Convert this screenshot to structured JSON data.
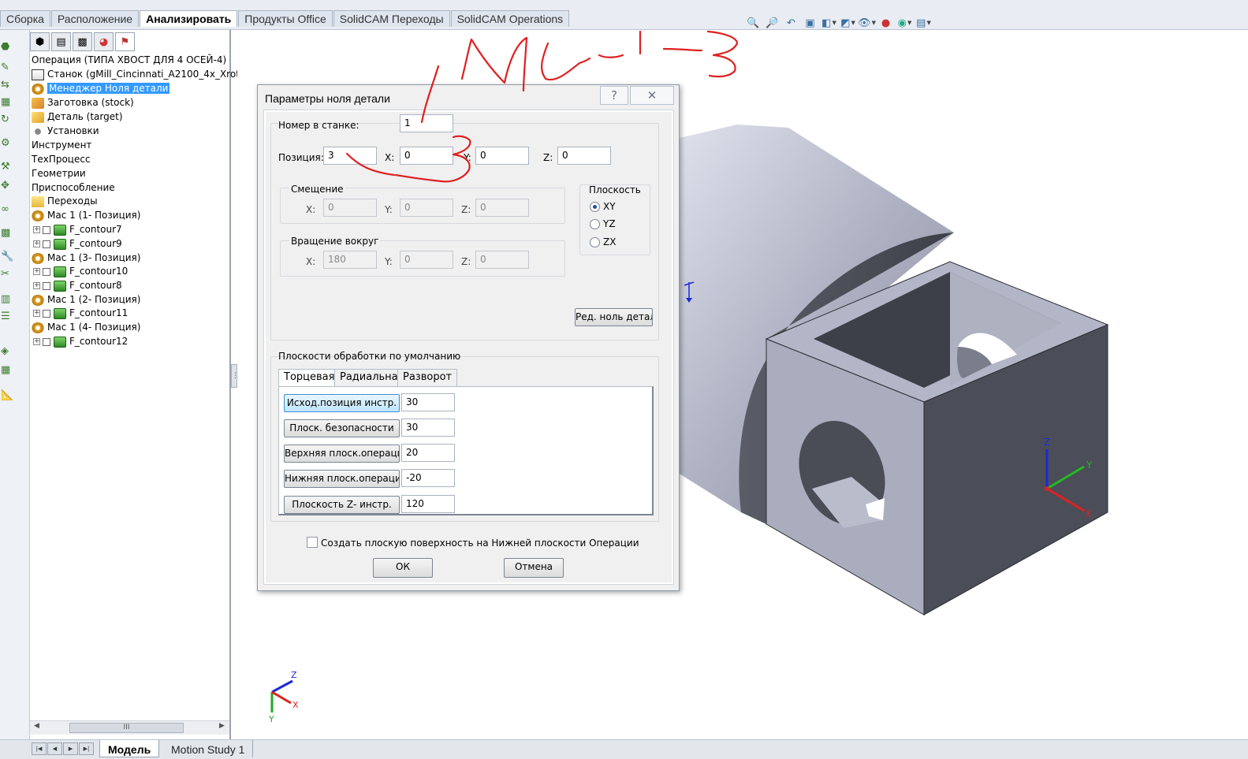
{
  "ribbon": {
    "tabs": [
      "Сборка",
      "Расположение",
      "Анализировать",
      "Продукты Office",
      "SolidCAM Переходы",
      "SolidCAM Operations"
    ],
    "active_tab": "Анализировать"
  },
  "view_toolbar": {
    "icons": [
      "zoom-to-fit-icon",
      "zoom-area-icon",
      "previous-view-icon",
      "section-view-icon",
      "view-orientation-icon",
      "display-style-icon",
      "hide-show-icon",
      "appearance-icon",
      "scene-icon",
      "view-settings-icon"
    ]
  },
  "tree": {
    "root": "Операция (ТИПА ХВОСТ ДЛЯ 4 ОСЕЙ-4)",
    "machine": "Станок (gMill_Cincinnati_A2100_4x_Xrot",
    "part_zero_manager": "Менеджер Ноля детали",
    "stock": "Заготовка (stock)",
    "target": "Деталь (target)",
    "setups": "Установки",
    "tool": "Инструмент",
    "process": "ТехПроцесс",
    "geometry": "Геометрии",
    "fixture": "Приспособление",
    "operations": "Переходы",
    "groups": [
      {
        "label": "Мас 1 (1- Позиция)",
        "items": [
          "F_contour7",
          "F_contour9"
        ]
      },
      {
        "label": "Мас 1 (3- Позиция)",
        "items": [
          "F_contour10",
          "F_contour8"
        ]
      },
      {
        "label": "Мас 1 (2- Позиция)",
        "items": [
          "F_contour11"
        ]
      },
      {
        "label": "Мас 1 (4- Позиция)",
        "items": [
          "F_contour12"
        ]
      }
    ],
    "scroll_thumb": "III"
  },
  "bottom": {
    "model_tab": "Модель",
    "motion_tab": "Motion Study 1"
  },
  "dialog": {
    "title": "Параметры ноля детали",
    "help_glyph": "?",
    "close_glyph": "✕",
    "machine_number_label": "Номер в станке:",
    "machine_number": "1",
    "position_label": "Позиция:",
    "position": "3",
    "pos_x_label": "X:",
    "pos_x": "0",
    "pos_y_label": "Y:",
    "pos_y": "0",
    "pos_z_label": "Z:",
    "pos_z": "0",
    "shift": {
      "title": "Смещение",
      "x_label": "X:",
      "x": "0",
      "y_label": "Y:",
      "y": "0",
      "z_label": "Z:",
      "z": "0"
    },
    "rotation": {
      "title": "Вращение вокруг",
      "x_label": "X:",
      "x": "180",
      "y_label": "Y:",
      "y": "0",
      "z_label": "Z:",
      "z": "0"
    },
    "plane": {
      "title": "Плоскость",
      "options": [
        "XY",
        "YZ",
        "ZX"
      ],
      "selected": "XY"
    },
    "edit_zero_button": "Ред. ноль детали",
    "default_planes": {
      "title": "Плоскости обработки по умолчанию",
      "tabs": [
        "Торцевая",
        "Радиальная",
        "Разворот"
      ],
      "active_tab": "Торцевая",
      "rows": [
        {
          "button": "Исход.позиция инстр.",
          "value": "30"
        },
        {
          "button": "Плоск. безопасности",
          "value": "30"
        },
        {
          "button": "Верхняя плоск.операции",
          "value": "20"
        },
        {
          "button": "Нижняя плоск.операции",
          "value": "-20"
        },
        {
          "button": "Плоскость Z- инстр.",
          "value": "120"
        }
      ]
    },
    "flat_surface_checkbox": "Создать плоскую поверхность на Нижней плоскости Операции",
    "ok_button": "ОК",
    "cancel_button": "Отмена"
  },
  "annotation": {
    "handwritten": "Мас 1-3",
    "color": "#e02020"
  },
  "triad": {
    "x": "X",
    "y": "Y",
    "z": "Z"
  },
  "colors": {
    "accent_selection": "#3399ff",
    "model_face_light": "#b9bccb",
    "model_face_dark": "#4a4c57"
  }
}
